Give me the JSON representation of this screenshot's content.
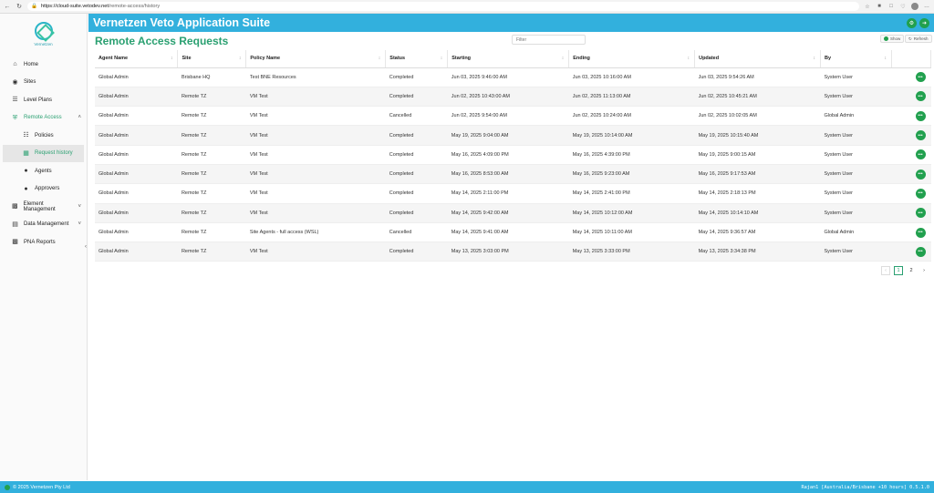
{
  "browser": {
    "url_host": "https://cloud-suite.vetodev.net",
    "url_path": "/remote-access/history"
  },
  "app": {
    "title": "Vernetzen Veto Application Suite",
    "logo_text": "Vernetzen"
  },
  "sidebar": {
    "items": [
      {
        "label": "Home"
      },
      {
        "label": "Sites"
      },
      {
        "label": "Level Plans"
      },
      {
        "label": "Remote Access"
      },
      {
        "label": "Policies"
      },
      {
        "label": "Request history"
      },
      {
        "label": "Agents"
      },
      {
        "label": "Approvers"
      },
      {
        "label": "Element Management"
      },
      {
        "label": "Data Management"
      },
      {
        "label": "PNA Reports"
      }
    ]
  },
  "main": {
    "title": "Remote Access Requests",
    "filter_placeholder": "Filter",
    "show_label": "Show",
    "refresh_label": "Refresh",
    "columns": [
      "Agent Name",
      "Site",
      "Policy Name",
      "Status",
      "Starting",
      "Ending",
      "Updated",
      "By"
    ],
    "rows": [
      [
        "Global Admin",
        "Brisbane HQ",
        "Test BNE Resources",
        "Completed",
        "Jun 03, 2025 9:46:00 AM",
        "Jun 03, 2025 10:16:00 AM",
        "Jun 03, 2025 9:54:26 AM",
        "System User"
      ],
      [
        "Global Admin",
        "Remote TZ",
        "VM Test",
        "Completed",
        "Jun 02, 2025 10:43:00 AM",
        "Jun 02, 2025 11:13:00 AM",
        "Jun 02, 2025 10:45:21 AM",
        "System User"
      ],
      [
        "Global Admin",
        "Remote TZ",
        "VM Test",
        "Cancelled",
        "Jun 02, 2025 9:54:00 AM",
        "Jun 02, 2025 10:24:00 AM",
        "Jun 02, 2025 10:02:05 AM",
        "Global Admin"
      ],
      [
        "Global Admin",
        "Remote TZ",
        "VM Test",
        "Completed",
        "May 19, 2025 9:04:00 AM",
        "May 19, 2025 10:14:00 AM",
        "May 19, 2025 10:15:40 AM",
        "System User"
      ],
      [
        "Global Admin",
        "Remote TZ",
        "VM Test",
        "Completed",
        "May 16, 2025 4:09:00 PM",
        "May 16, 2025 4:39:00 PM",
        "May 19, 2025 9:00:15 AM",
        "System User"
      ],
      [
        "Global Admin",
        "Remote TZ",
        "VM Test",
        "Completed",
        "May 16, 2025 8:53:00 AM",
        "May 16, 2025 9:23:00 AM",
        "May 16, 2025 9:17:53 AM",
        "System User"
      ],
      [
        "Global Admin",
        "Remote TZ",
        "VM Test",
        "Completed",
        "May 14, 2025 2:11:00 PM",
        "May 14, 2025 2:41:00 PM",
        "May 14, 2025 2:18:13 PM",
        "System User"
      ],
      [
        "Global Admin",
        "Remote TZ",
        "VM Test",
        "Completed",
        "May 14, 2025 9:42:00 AM",
        "May 14, 2025 10:12:00 AM",
        "May 14, 2025 10:14:10 AM",
        "System User"
      ],
      [
        "Global Admin",
        "Remote TZ",
        "Site Agents - full access (WSL)",
        "Cancelled",
        "May 14, 2025 9:41:00 AM",
        "May 14, 2025 10:11:00 AM",
        "May 14, 2025 9:36:57 AM",
        "Global Admin"
      ],
      [
        "Global Admin",
        "Remote TZ",
        "VM Test",
        "Completed",
        "May 13, 2025 3:03:00 PM",
        "May 13, 2025 3:33:00 PM",
        "May 13, 2025 3:34:38 PM",
        "System User"
      ]
    ],
    "pagination": {
      "pages": [
        "1",
        "2"
      ],
      "current": "1"
    }
  },
  "footer": {
    "copyright": "2025 Vernetzen Pty Ltd",
    "status": "Rajan1 [Australia/Brisbane +10 hours] 0.5.1.0"
  },
  "colors": {
    "header": "#32b0dd",
    "accent": "#2aa071",
    "button": "#21a04e"
  }
}
